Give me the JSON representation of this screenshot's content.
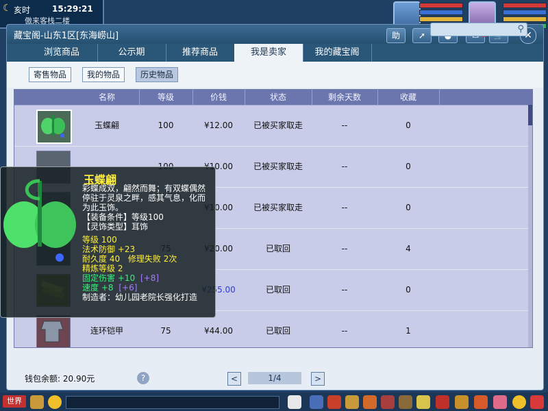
{
  "hud": {
    "shichen": "亥时",
    "time": "15:29:21",
    "location": "傲来客栈二楼"
  },
  "window": {
    "title": "藏宝阁-山东1区[东海崂山]",
    "help_label": "助",
    "msg_count": "2",
    "close_label": "✕"
  },
  "tabs": [
    {
      "label": "浏览商品"
    },
    {
      "label": "公示期"
    },
    {
      "label": "推荐商品"
    },
    {
      "label": "我是卖家"
    },
    {
      "label": "我的藏宝阁"
    }
  ],
  "subtabs": [
    {
      "label": "寄售物品"
    },
    {
      "label": "我的物品"
    },
    {
      "label": "历史物品"
    }
  ],
  "table": {
    "headers": [
      "名称",
      "等级",
      "价钱",
      "状态",
      "剩余天数",
      "收藏"
    ],
    "rows": [
      {
        "name": "玉蝶翩",
        "level": "100",
        "price": "¥12.00",
        "status": "已被买家取走",
        "days": "--",
        "fav": "0"
      },
      {
        "name": "",
        "level": "100",
        "price": "¥10.00",
        "status": "已被买家取走",
        "days": "--",
        "fav": "0"
      },
      {
        "name": "",
        "level": "",
        "price": "¥10.00",
        "status": "已被买家取走",
        "days": "--",
        "fav": "0"
      },
      {
        "name": "",
        "level": "75",
        "price": "¥20.00",
        "status": "已取回",
        "days": "--",
        "fav": "4"
      },
      {
        "name": "",
        "level": "",
        "price": "¥255.00",
        "status": "已取回",
        "days": "--",
        "fav": "0"
      },
      {
        "name": "连环铠甲",
        "level": "75",
        "price": "¥44.00",
        "status": "已取回",
        "days": "--",
        "fav": "1"
      }
    ]
  },
  "footer": {
    "wallet": "钱包余额: 20.90元",
    "help": "?",
    "page": "1/4",
    "prev": "<",
    "next": ">"
  },
  "tooltip": {
    "name": "玉蝶翩",
    "desc": "彩蝶成双，翩然而舞；有双蝶偶然停驻于灵泉之畔，感其气息，化而为此玉饰。",
    "set": "【装备条件】等级100",
    "type": "【灵饰类型】耳饰",
    "level": "等级 100",
    "mdef": "法术防御 +23",
    "durability": "耐久度 40",
    "repair": "修理失败 2次",
    "refine": "精炼等级 2",
    "fixed_dmg": "固定伤害 +10",
    "fixed_dmg_bonus": "[+8]",
    "speed": "速度 +8",
    "speed_bonus": "[+6]",
    "maker": "制造者：幼儿园老院长强化打造"
  },
  "bottombar": {
    "world": "世界"
  },
  "colors": {
    "hud_bg": "#1f3f63",
    "title_bg": "#25506f",
    "table_bg": "#9fa6cf",
    "tooltip_name": "#ffef3a",
    "tooltip_green": "#34f37a",
    "tooltip_purple": "#a57cff"
  }
}
